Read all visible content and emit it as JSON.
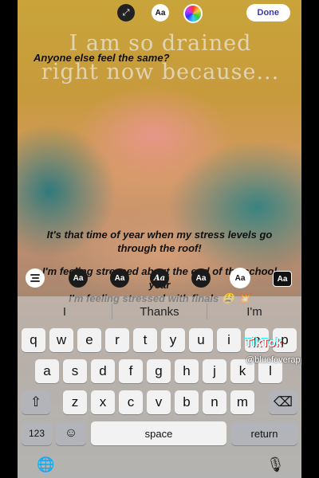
{
  "toolbar": {
    "resize_icon": "resize-icon",
    "font_label": "Aa",
    "color_icon": "color-wheel-icon",
    "done_label": "Done"
  },
  "background_text": {
    "line1": "I am so drained",
    "line2": "right now because..."
  },
  "story_texts": [
    "Anyone else feel the same?",
    "It's that time of year when my stress levels go through the roof!",
    "I'm feeling stressed about the end of the school year",
    "I'm feeling stressed with finals 😩 💥"
  ],
  "font_styles": [
    {
      "label": "Aa"
    },
    {
      "label": "Aa"
    },
    {
      "label": "Aa"
    },
    {
      "label": "Aa"
    },
    {
      "label": "Aa"
    },
    {
      "label": "Aa"
    }
  ],
  "suggestions": [
    "I",
    "Thanks",
    "I'm"
  ],
  "keyboard": {
    "row1": [
      "q",
      "w",
      "e",
      "r",
      "t",
      "y",
      "u",
      "i",
      "o",
      "p"
    ],
    "row2": [
      "a",
      "s",
      "d",
      "f",
      "g",
      "h",
      "j",
      "k",
      "l"
    ],
    "row3": [
      "z",
      "x",
      "c",
      "v",
      "b",
      "n",
      "m"
    ],
    "numbers_label": "123",
    "space_label": "space",
    "return_label": "return",
    "shift_icon": "shift-icon",
    "delete_icon": "backspace-icon",
    "emoji_icon": "emoji-icon",
    "globe_icon": "globe-icon",
    "mic_icon": "microphone-icon"
  },
  "watermark": {
    "brand": "TikTok",
    "username": "@bluefeverapp"
  }
}
